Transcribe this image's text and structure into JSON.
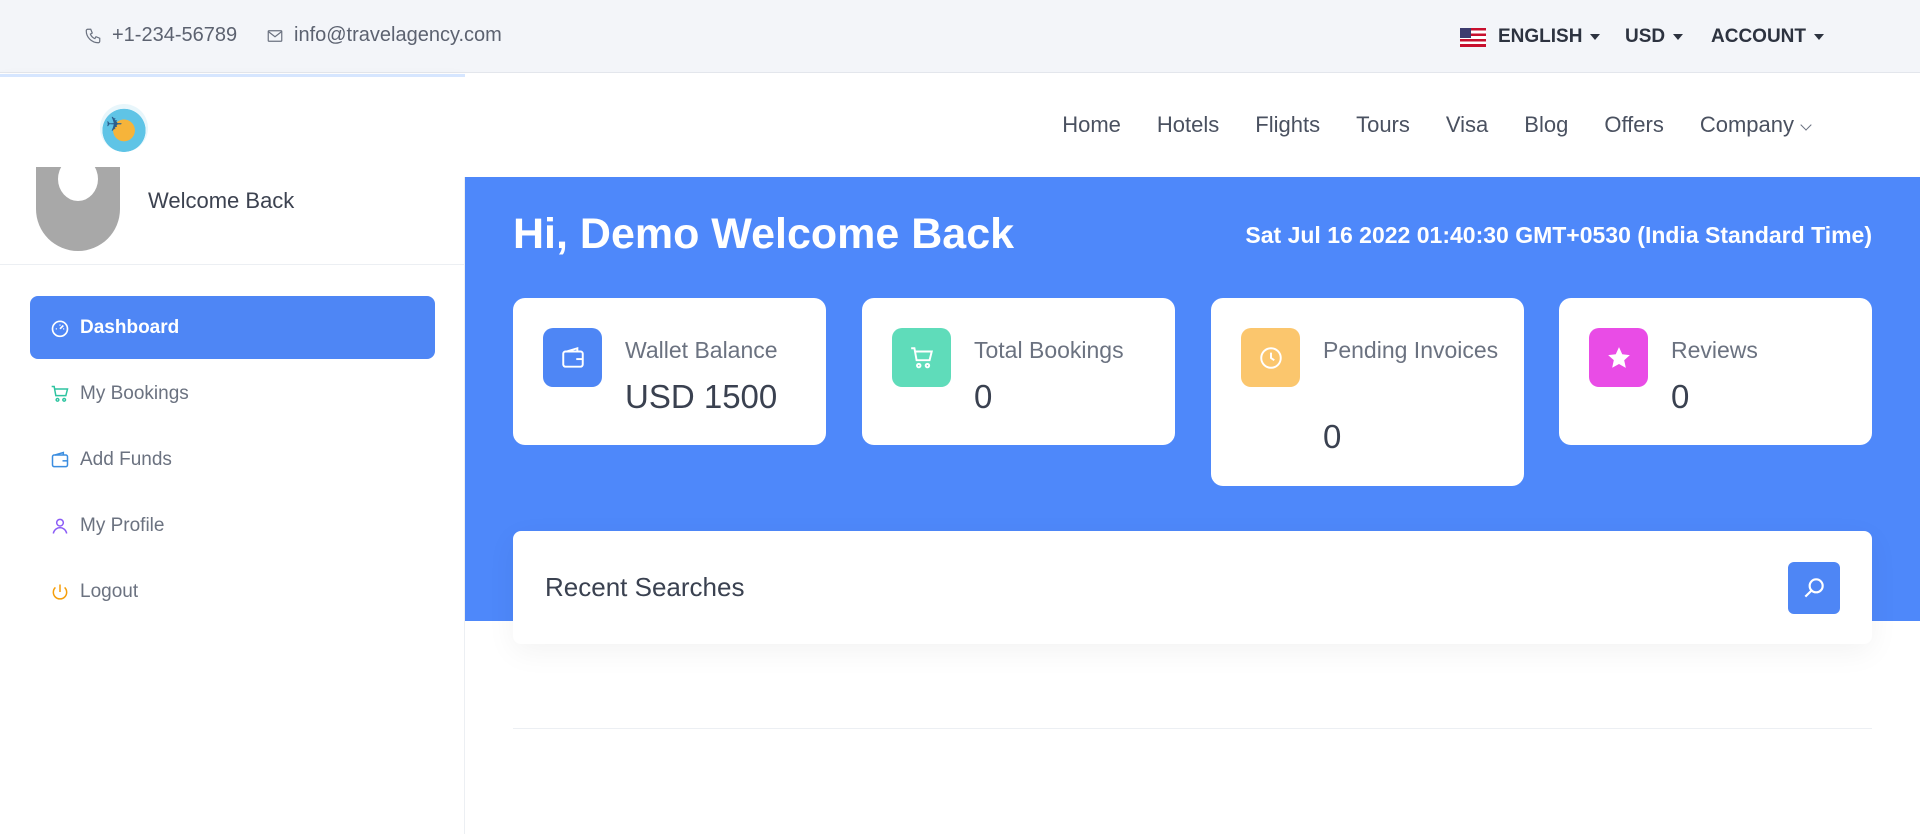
{
  "topbar": {
    "phone": "+1-234-56789",
    "email": "info@travelagency.com",
    "language": "ENGLISH",
    "currency": "USD",
    "account": "ACCOUNT"
  },
  "nav": {
    "links": [
      "Home",
      "Hotels",
      "Flights",
      "Tours",
      "Visa",
      "Blog",
      "Offers",
      "Company"
    ]
  },
  "sidebar": {
    "welcome": "Welcome Back",
    "items": [
      {
        "label": "Dashboard",
        "icon": "dashboard-icon",
        "color": "#ffffff"
      },
      {
        "label": "My Bookings",
        "icon": "cart-icon",
        "color": "#2ec4a0"
      },
      {
        "label": "Add Funds",
        "icon": "wallet-icon",
        "color": "#3b8de0"
      },
      {
        "label": "My Profile",
        "icon": "user-icon",
        "color": "#8b5cf6"
      },
      {
        "label": "Logout",
        "icon": "power-icon",
        "color": "#f59e0b"
      }
    ]
  },
  "main": {
    "greeting": "Hi, Demo Welcome Back",
    "datetime": "Sat Jul 16 2022 01:40:30 GMT+0530 (India Standard Time)",
    "cards": [
      {
        "label": "Wallet Balance",
        "value": "USD 1500",
        "icon": "wallet-icon",
        "color": "#4e86f5"
      },
      {
        "label": "Total Bookings",
        "value": "0",
        "icon": "cart-icon",
        "color": "#5fdcba"
      },
      {
        "label": "Pending Invoices",
        "value": "0",
        "icon": "clock-icon",
        "color": "#fbc66d"
      },
      {
        "label": "Reviews",
        "value": "0",
        "icon": "star-icon",
        "color": "#e94ce6"
      }
    ],
    "recent_title": "Recent Searches"
  },
  "colors": {
    "accent": "#4e88fa"
  }
}
